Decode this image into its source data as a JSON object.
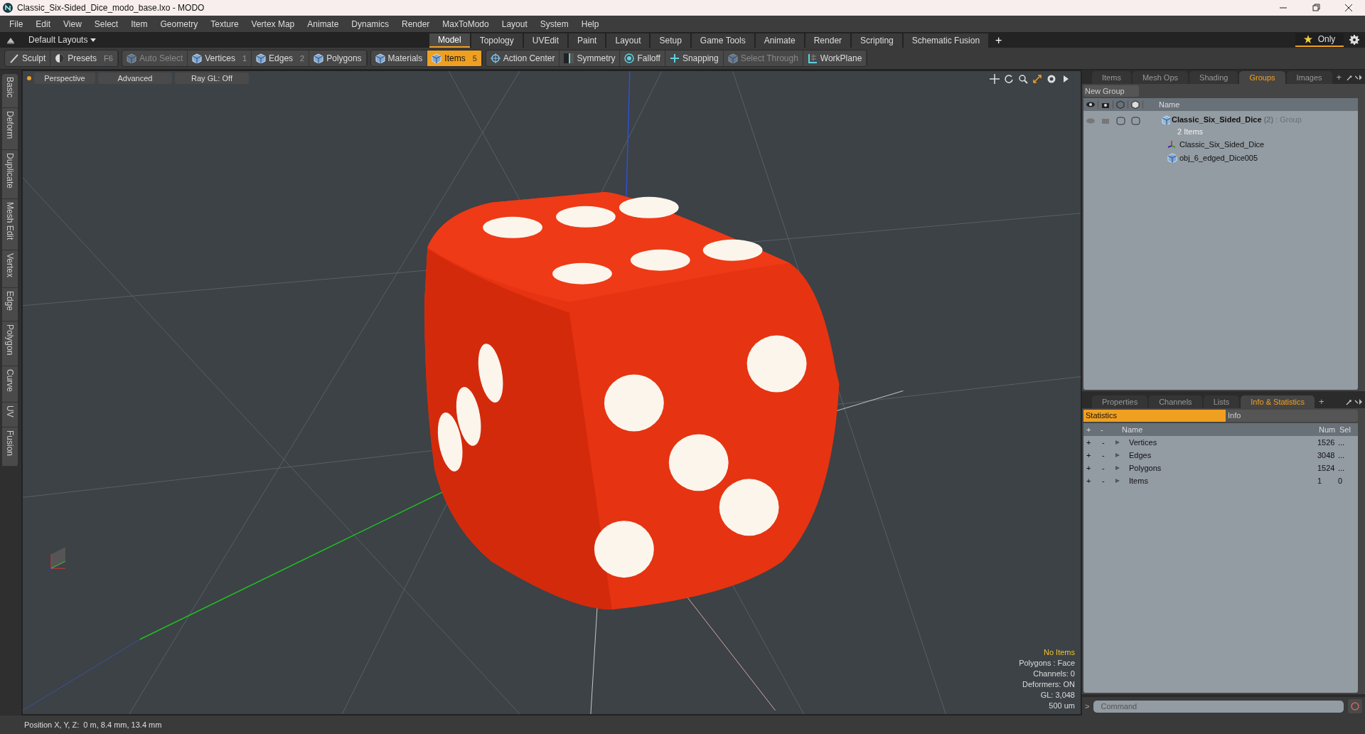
{
  "window": {
    "title": "Classic_Six-Sided_Dice_modo_base.lxo - MODO"
  },
  "menu": [
    "File",
    "Edit",
    "View",
    "Select",
    "Item",
    "Geometry",
    "Texture",
    "Vertex Map",
    "Animate",
    "Dynamics",
    "Render",
    "MaxToModo",
    "Layout",
    "System",
    "Help"
  ],
  "layout_bar": {
    "layouts": "Default Layouts",
    "tabs": [
      {
        "label": "Model",
        "selected": true
      },
      {
        "label": "Topology",
        "selected": false
      },
      {
        "label": "UVEdit",
        "selected": false
      },
      {
        "label": "Paint",
        "selected": false
      },
      {
        "label": "Layout",
        "selected": false
      },
      {
        "label": "Setup",
        "selected": false
      },
      {
        "label": "Game Tools",
        "selected": false
      },
      {
        "label": "Animate",
        "selected": false
      },
      {
        "label": "Render",
        "selected": false
      },
      {
        "label": "Scripting",
        "selected": false
      },
      {
        "label": "Schematic Fusion",
        "selected": false
      }
    ],
    "add": "+",
    "only": "Only"
  },
  "toolbar": [
    {
      "label": "Sculpt",
      "kind": "brush",
      "selected": false,
      "disabled": false
    },
    {
      "label": "Presets",
      "shortcut": "F6",
      "kind": "sphere",
      "selected": false,
      "disabled": false
    },
    {
      "label": "Auto Select",
      "kind": "cube",
      "selected": false,
      "disabled": true
    },
    {
      "label": "Vertices",
      "shortcut": "1",
      "kind": "cube",
      "selected": false,
      "disabled": false
    },
    {
      "label": "Edges",
      "shortcut": "2",
      "kind": "cube",
      "selected": false,
      "disabled": false
    },
    {
      "label": "Polygons",
      "kind": "cube",
      "selected": false,
      "disabled": false
    },
    {
      "label": "Materials",
      "kind": "cube",
      "selected": false,
      "disabled": false
    },
    {
      "label": "Items",
      "shortcut": "5",
      "kind": "cube",
      "selected": true,
      "disabled": false
    },
    {
      "label": "Action Center",
      "kind": "crosshair",
      "selected": false,
      "disabled": false
    },
    {
      "label": "Symmetry",
      "kind": "symmetry",
      "selected": false,
      "disabled": false
    },
    {
      "label": "Falloff",
      "kind": "target",
      "selected": false,
      "disabled": false
    },
    {
      "label": "Snapping",
      "kind": "snap",
      "selected": false,
      "disabled": false
    },
    {
      "label": "Select Through",
      "kind": "cube",
      "selected": false,
      "disabled": true
    },
    {
      "label": "WorkPlane",
      "kind": "grid",
      "selected": false,
      "disabled": false
    }
  ],
  "side_tabs": [
    "Basic",
    "Deform",
    "Duplicate",
    "Mesh Edit",
    "Vertex",
    "Edge",
    "Polygon",
    "Curve",
    "UV",
    "Fusion"
  ],
  "viewport": {
    "buttons": [
      "Perspective",
      "Advanced",
      "Ray GL: Off"
    ],
    "info": [
      {
        "text": "No Items",
        "highlighted": true
      },
      {
        "text": "Polygons : Face",
        "highlighted": false
      },
      {
        "text": "Channels: 0",
        "highlighted": false
      },
      {
        "text": "Deformers: ON",
        "highlighted": false
      },
      {
        "text": "GL: 3,048",
        "highlighted": false
      },
      {
        "text": "500 um",
        "highlighted": false
      }
    ]
  },
  "groups_panel": {
    "tabs": [
      {
        "label": "Items",
        "selected": false
      },
      {
        "label": "Mesh Ops",
        "selected": false
      },
      {
        "label": "Shading",
        "selected": false
      },
      {
        "label": "Groups",
        "selected": true
      },
      {
        "label": "Images",
        "selected": false
      }
    ],
    "new_group": "New Group",
    "column": "Name",
    "group": {
      "name": "Classic_Six_Sided_Dice",
      "count": "(2)",
      "type": ": Group",
      "subtitle": "2 Items",
      "children": [
        {
          "name": "Classic_Six_Sided_Dice",
          "kind": "locator"
        },
        {
          "name": "obj_6_edged_Dice005",
          "kind": "mesh"
        }
      ]
    }
  },
  "stats_panel": {
    "tabs": [
      {
        "label": "Properties",
        "selected": false
      },
      {
        "label": "Channels",
        "selected": false
      },
      {
        "label": "Lists",
        "selected": false
      },
      {
        "label": "Info & Statistics",
        "selected": true
      }
    ],
    "subtabs": [
      {
        "label": "Statistics",
        "selected": true
      },
      {
        "label": "Info",
        "selected": false
      }
    ],
    "columns": [
      "+",
      "-",
      "Name",
      "Num",
      "Sel"
    ],
    "rows": [
      {
        "plus": "+",
        "minus": "-",
        "name": "Vertices",
        "num": "1526",
        "sel": "..."
      },
      {
        "plus": "+",
        "minus": "-",
        "name": "Edges",
        "num": "3048",
        "sel": "..."
      },
      {
        "plus": "+",
        "minus": "-",
        "name": "Polygons",
        "num": "1524",
        "sel": "..."
      },
      {
        "plus": "+",
        "minus": "-",
        "name": "Items",
        "num": "1",
        "sel": "0"
      }
    ]
  },
  "command": {
    "prompt": ">",
    "placeholder": "Command"
  },
  "status_bar": "Position X, Y, Z:  0 m, 8.4 mm, 13.4 mm"
}
